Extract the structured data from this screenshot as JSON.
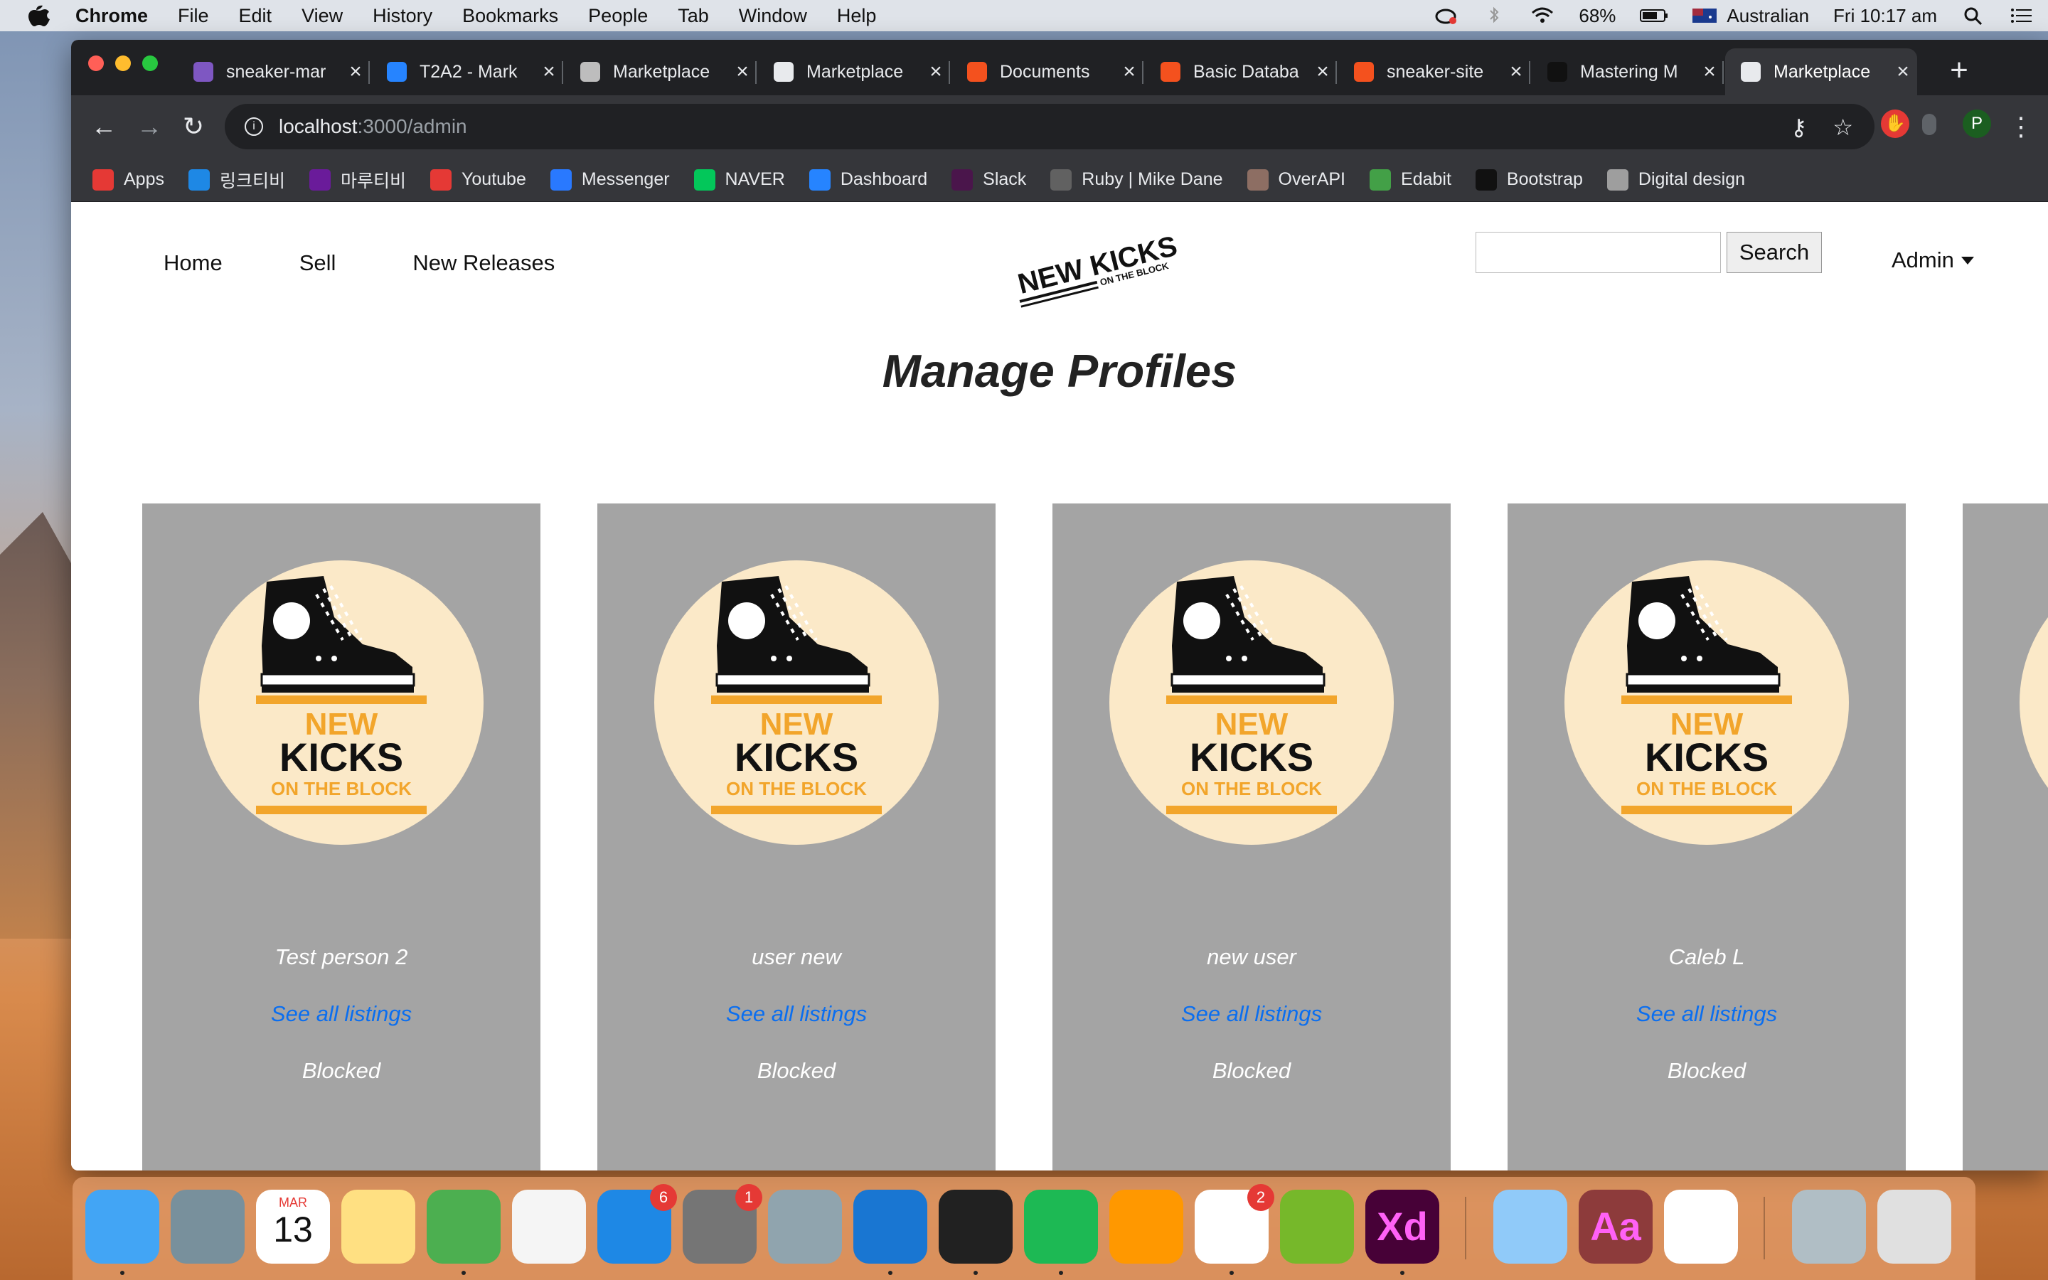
{
  "menubar": {
    "app_name": "Chrome",
    "menus": [
      "File",
      "Edit",
      "View",
      "History",
      "Bookmarks",
      "People",
      "Tab",
      "Window",
      "Help"
    ],
    "battery": "68%",
    "input_source": "Australian",
    "clock": "Fri 10:17 am"
  },
  "browser": {
    "tabs": [
      {
        "title": "sneaker-mar",
        "icon": "heroku-icon",
        "color": "#7e57c2"
      },
      {
        "title": "T2A2 - Mark",
        "icon": "atlassian-icon",
        "color": "#2684ff"
      },
      {
        "title": "Marketplace",
        "icon": "page-icon",
        "color": "#bdbdbd"
      },
      {
        "title": "Marketplace",
        "icon": "globe-icon",
        "color": "#e8eaed"
      },
      {
        "title": "Documents",
        "icon": "docs-icon",
        "color": "#f4511e"
      },
      {
        "title": "Basic Databa",
        "icon": "docs-icon",
        "color": "#f4511e"
      },
      {
        "title": "sneaker-site",
        "icon": "docs-icon",
        "color": "#f4511e"
      },
      {
        "title": "Mastering M",
        "icon": "github-icon",
        "color": "#111111"
      },
      {
        "title": "Marketplace",
        "icon": "globe-icon",
        "color": "#e8eaed",
        "active": true
      }
    ],
    "new_tab": "+",
    "url_host": "localhost",
    "url_path": ":3000/admin",
    "profile_initial": "P",
    "bookmarks": [
      {
        "label": "Apps",
        "color": "#e53935"
      },
      {
        "label": "링크티비",
        "color": "#1e88e5"
      },
      {
        "label": "마루티비",
        "color": "#6a1b9a"
      },
      {
        "label": "Youtube",
        "color": "#e53935"
      },
      {
        "label": "Messenger",
        "color": "#2979ff"
      },
      {
        "label": "NAVER",
        "color": "#03c75a"
      },
      {
        "label": "Dashboard",
        "color": "#2684ff"
      },
      {
        "label": "Slack",
        "color": "#4a154b"
      },
      {
        "label": "Ruby | Mike Dane",
        "color": "#616161"
      },
      {
        "label": "OverAPI",
        "color": "#8d6e63"
      },
      {
        "label": "Edabit",
        "color": "#43a047"
      },
      {
        "label": "Bootstrap",
        "color": "#111111"
      },
      {
        "label": "Digital design",
        "color": "#9e9e9e"
      }
    ]
  },
  "site": {
    "nav": [
      "Home",
      "Sell",
      "New Releases"
    ],
    "logo_text": [
      "NEW KICKS",
      "ON THE BLOCK"
    ],
    "search_button": "Search",
    "search_placeholder": "",
    "admin_label": "Admin",
    "page_title": "Manage Profiles",
    "avatar_text": [
      "NEW",
      "KICKS",
      "ON THE BLOCK"
    ],
    "profiles": [
      {
        "name": "Test person 2",
        "link": "See all listings",
        "status": "Blocked"
      },
      {
        "name": "user new",
        "link": "See all listings",
        "status": "Blocked"
      },
      {
        "name": "new user",
        "link": "See all listings",
        "status": "Blocked"
      },
      {
        "name": "Caleb L",
        "link": "See all listings",
        "status": "Blocked"
      }
    ]
  },
  "dock": {
    "apps": [
      {
        "name": "finder-icon",
        "color": "#42a5f5",
        "running": true
      },
      {
        "name": "launchpad-icon",
        "color": "#78909c"
      },
      {
        "name": "calendar-icon",
        "color": "#ffffff",
        "month": "MAR",
        "day": "13"
      },
      {
        "name": "notes-icon",
        "color": "#ffe082"
      },
      {
        "name": "chrome-icon",
        "color": "#4caf50",
        "running": true
      },
      {
        "name": "photos-icon",
        "color": "#f5f5f5"
      },
      {
        "name": "app-store-icon",
        "color": "#1e88e5",
        "badge": "6"
      },
      {
        "name": "system-preferences-icon",
        "color": "#757575",
        "badge": "1"
      },
      {
        "name": "preview-icon",
        "color": "#90a4ae"
      },
      {
        "name": "vscode-icon",
        "color": "#1976d2",
        "running": true
      },
      {
        "name": "terminal-icon",
        "color": "#212121",
        "running": true
      },
      {
        "name": "spotify-icon",
        "color": "#1db954",
        "running": true
      },
      {
        "name": "pages-icon",
        "color": "#ff9800"
      },
      {
        "name": "slack-icon",
        "color": "#ffffff",
        "badge": "2",
        "running": true
      },
      {
        "name": "utorrent-icon",
        "color": "#76b82a"
      },
      {
        "name": "adobe-xd-icon",
        "color": "#470137",
        "label": "Xd",
        "running": true
      },
      {
        "name": "mail-icon",
        "color": "#90caf9"
      },
      {
        "name": "dictionary-icon",
        "color": "#8d3b3b",
        "label": "Aa"
      },
      {
        "name": "sequel-pro-icon",
        "color": "#ffffff"
      },
      {
        "name": "downloads-stack-icon",
        "color": "#b0bec5"
      },
      {
        "name": "trash-icon",
        "color": "#e0e0e0"
      }
    ]
  }
}
